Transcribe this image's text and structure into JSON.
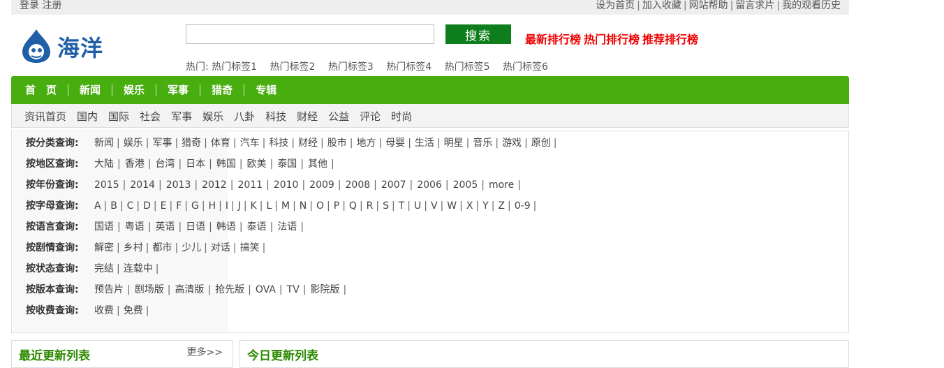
{
  "topbar": {
    "left": [
      "登录",
      "注册"
    ],
    "right": [
      "设为首页",
      "加入收藏",
      "网站帮助",
      "留言求片",
      "我的观看历史"
    ]
  },
  "logo": {
    "text": "海洋"
  },
  "search": {
    "value": "",
    "placeholder": "",
    "button": "搜索"
  },
  "ranks": [
    "最新排行榜",
    "热门排行榜",
    "推荐排行榜"
  ],
  "hot": {
    "label": "热门:",
    "tags": [
      "热门标签1",
      "热门标签2",
      "热门标签3",
      "热门标签4",
      "热门标签5",
      "热门标签6"
    ]
  },
  "mainnav": [
    "首　页",
    "新闻",
    "娱乐",
    "军事",
    "猎奇",
    "专辑"
  ],
  "subnav": [
    "资讯首页",
    "国内",
    "国际",
    "社会",
    "军事",
    "娱乐",
    "八卦",
    "科技",
    "财经",
    "公益",
    "评论",
    "时尚"
  ],
  "filters": [
    {
      "label": "按分类查询:",
      "options": [
        "新闻",
        "娱乐",
        "军事",
        "猎奇",
        "体育",
        "汽车",
        "科技",
        "财经",
        "股市",
        "地方",
        "母婴",
        "生活",
        "明星",
        "音乐",
        "游戏",
        "原创"
      ]
    },
    {
      "label": "按地区查询:",
      "options": [
        "大陆",
        "香港",
        "台湾",
        "日本",
        "韩国",
        "欧美",
        "泰国",
        "其他"
      ]
    },
    {
      "label": "按年份查询:",
      "options": [
        "2015",
        "2014",
        "2013",
        "2012",
        "2011",
        "2010",
        "2009",
        "2008",
        "2007",
        "2006",
        "2005",
        "more"
      ]
    },
    {
      "label": "按字母查询:",
      "options": [
        "A",
        "B",
        "C",
        "D",
        "E",
        "F",
        "G",
        "H",
        "I",
        "J",
        "K",
        "L",
        "M",
        "N",
        "O",
        "P",
        "Q",
        "R",
        "S",
        "T",
        "U",
        "V",
        "W",
        "X",
        "Y",
        "Z",
        "0-9"
      ]
    },
    {
      "label": "按语言查询:",
      "options": [
        "国语",
        "粤语",
        "英语",
        "日语",
        "韩语",
        "泰语",
        "法语"
      ]
    },
    {
      "label": "按剧情查询:",
      "options": [
        "解密",
        "乡村",
        "都市",
        "少儿",
        "对话",
        "搞笑"
      ]
    },
    {
      "label": "按状态查询:",
      "options": [
        "完结",
        "连载中"
      ]
    },
    {
      "label": "按版本查询:",
      "options": [
        "预告片",
        "剧场版",
        "高清版",
        "抢先版",
        "OVA",
        "TV",
        "影院版"
      ]
    },
    {
      "label": "按收费查询:",
      "options": [
        "收费",
        "免费"
      ]
    }
  ],
  "panels": {
    "recent": {
      "title": "最近更新列表",
      "more": "更多>>"
    },
    "today": {
      "title": "今日更新列表"
    }
  },
  "colors": {
    "nav_green": "#48ad0f",
    "button_green": "#0e7d1c",
    "rank_red": "#ee0000",
    "title_green": "#2d8a00",
    "logo_blue": "#1f5fa8"
  }
}
